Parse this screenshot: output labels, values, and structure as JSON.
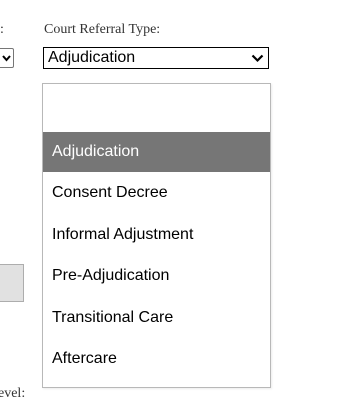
{
  "left_fragments": {
    "top_label": ":",
    "bottom_label": "evel:"
  },
  "court_referral": {
    "label": "Court Referral Type:",
    "selected_value": "Adjudication",
    "selected_color": "#767676",
    "chevron_icon": "chevron-down-icon",
    "options": [
      {
        "label": ""
      },
      {
        "label": "Adjudication"
      },
      {
        "label": "Consent Decree"
      },
      {
        "label": "Informal Adjustment"
      },
      {
        "label": "Pre-Adjudication"
      },
      {
        "label": "Transitional Care"
      },
      {
        "label": "Aftercare"
      }
    ]
  }
}
